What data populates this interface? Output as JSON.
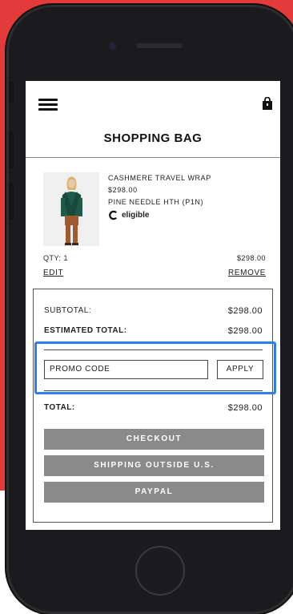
{
  "header": {
    "menu_icon": "hamburger-menu-icon",
    "bag_icon": "shopping-bag-icon",
    "title": "SHOPPING BAG"
  },
  "item": {
    "name": "CASHMERE TRAVEL WRAP",
    "price": "$298.00",
    "color": "PINE NEEDLE HTH (P1N)",
    "eligible_label": "eligible",
    "qty_label": "QTY: 1",
    "line_total": "$298.00",
    "edit_label": "EDIT",
    "remove_label": "REMOVE"
  },
  "summary": {
    "subtotal_label": "SUBTOTAL:",
    "subtotal_value": "$298.00",
    "estimated_label": "ESTIMATED TOTAL:",
    "estimated_value": "$298.00",
    "promo_placeholder": "PROMO CODE",
    "apply_label": "APPLY",
    "total_label": "TOTAL:",
    "total_value": "$298.00"
  },
  "actions": {
    "checkout_label": "CHECKOUT",
    "shipping_label": "SHIPPING OUTSIDE U.S.",
    "paypal_label": "PAYPAL"
  },
  "colors": {
    "background_red": "#e53a3a",
    "highlight_blue": "#2f7fe6",
    "button_gray": "#8a8a8a"
  }
}
